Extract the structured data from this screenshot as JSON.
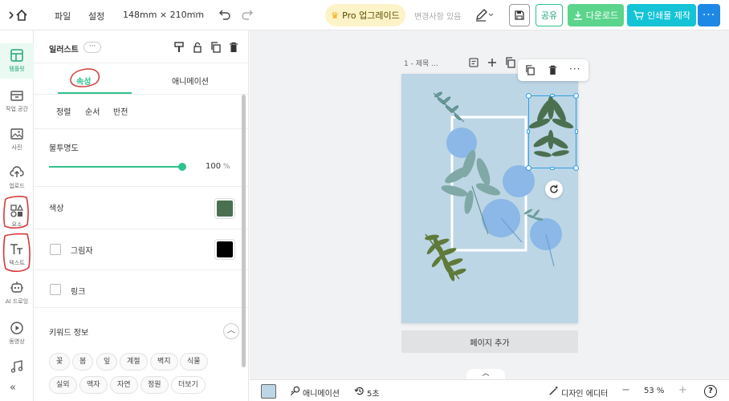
{
  "topbar": {
    "home_icon": "home-icon",
    "menu_file": "파일",
    "menu_settings": "설정",
    "page_size": "148mm × 210mm",
    "pro_button": "Pro 업그레이드",
    "save_status": "변경사항 있음",
    "share": "공유",
    "download": "다운로드",
    "print": "인쇄물 제작"
  },
  "rail": {
    "items": [
      {
        "label": "템플릿",
        "icon": "template-icon"
      },
      {
        "label": "작업 공간",
        "icon": "workspace-icon"
      },
      {
        "label": "사진",
        "icon": "photo-icon"
      },
      {
        "label": "업로드",
        "icon": "upload-icon"
      },
      {
        "label": "요소",
        "icon": "elements-icon"
      },
      {
        "label": "텍스트",
        "icon": "text-icon"
      },
      {
        "label": "AI 드로잉",
        "icon": "ai-drawing-icon"
      },
      {
        "label": "동영상",
        "icon": "video-icon"
      },
      {
        "label": "",
        "icon": "music-icon"
      }
    ]
  },
  "panel": {
    "title": "일러스트",
    "tabs": [
      "속성",
      "애니메이션"
    ],
    "active_tab": "속성",
    "actions": [
      "정렬",
      "순서",
      "반전"
    ],
    "opacity_label": "불투명도",
    "opacity_value": "100",
    "opacity_unit": "%",
    "opacity_level": 1.0,
    "color_label": "색상",
    "color_value": "#4a7050",
    "shadow_label": "그림자",
    "shadow_color": "#000000",
    "link_label": "링크",
    "keywords_label": "키워드 정보",
    "keywords": [
      "꽃",
      "봄",
      "잎",
      "계절",
      "벽지",
      "식물",
      "실외",
      "액자",
      "자연",
      "정원",
      "더보기"
    ]
  },
  "canvas": {
    "page_label": "1 - 제목 ...",
    "add_page": "페이지 추가",
    "background_color": "#bdd6e5"
  },
  "bottombar": {
    "animation": "애니메이션",
    "duration": "5초",
    "designer_editor": "디자인 에디터",
    "zoom": "53 %",
    "zoom_minus": "−",
    "zoom_plus": "+",
    "help": "?"
  },
  "colors": {
    "accent": "#2ec28b",
    "brand_blue": "#1e88e5",
    "download_green": "#5bd48c",
    "print_cyan": "#14c3d6",
    "selection": "#2e9ee6"
  }
}
